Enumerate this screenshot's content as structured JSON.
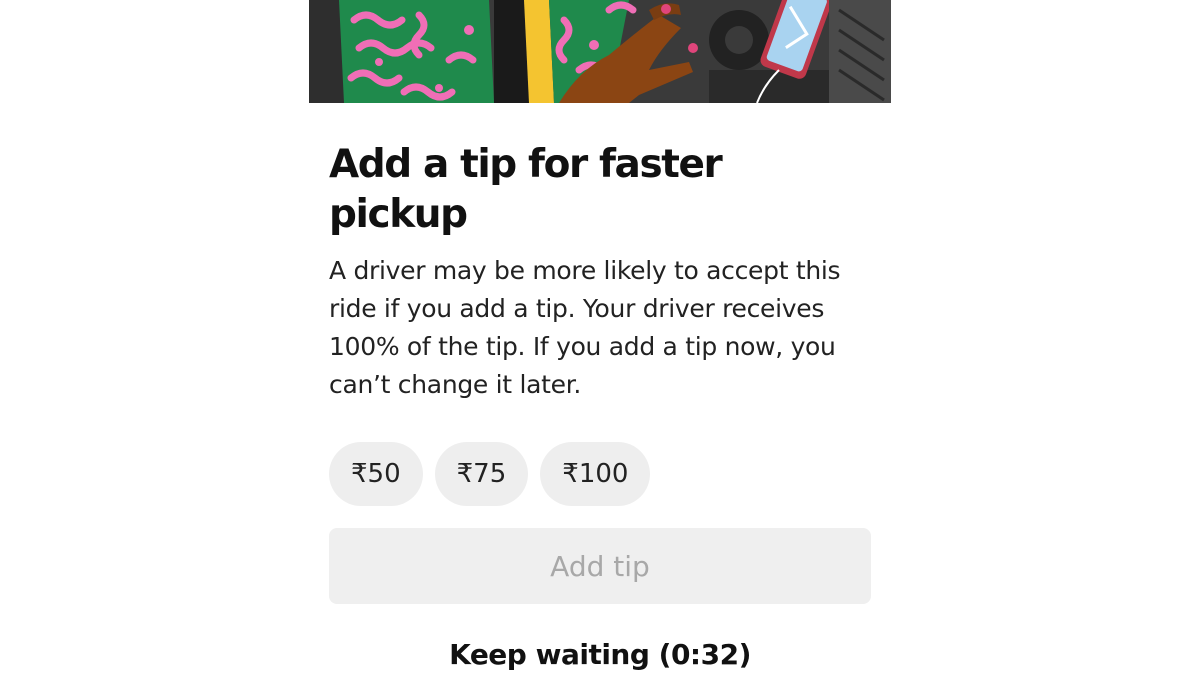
{
  "title": "Add a tip for faster pickup",
  "description": "A driver may be more likely to accept this ride if you add a tip. Your driver receives 100% of the tip. If you add a tip now, you can’t change it later.",
  "tip_options": [
    {
      "label": "₹50"
    },
    {
      "label": "₹75"
    },
    {
      "label": "₹100"
    }
  ],
  "add_tip_label": "Add tip",
  "keep_waiting_label": "Keep waiting (0:32)",
  "colors": {
    "chip_bg": "#eeeeee",
    "disabled_button_bg": "#efefef",
    "disabled_button_text": "#a8a8a8",
    "title_text": "#111111"
  }
}
